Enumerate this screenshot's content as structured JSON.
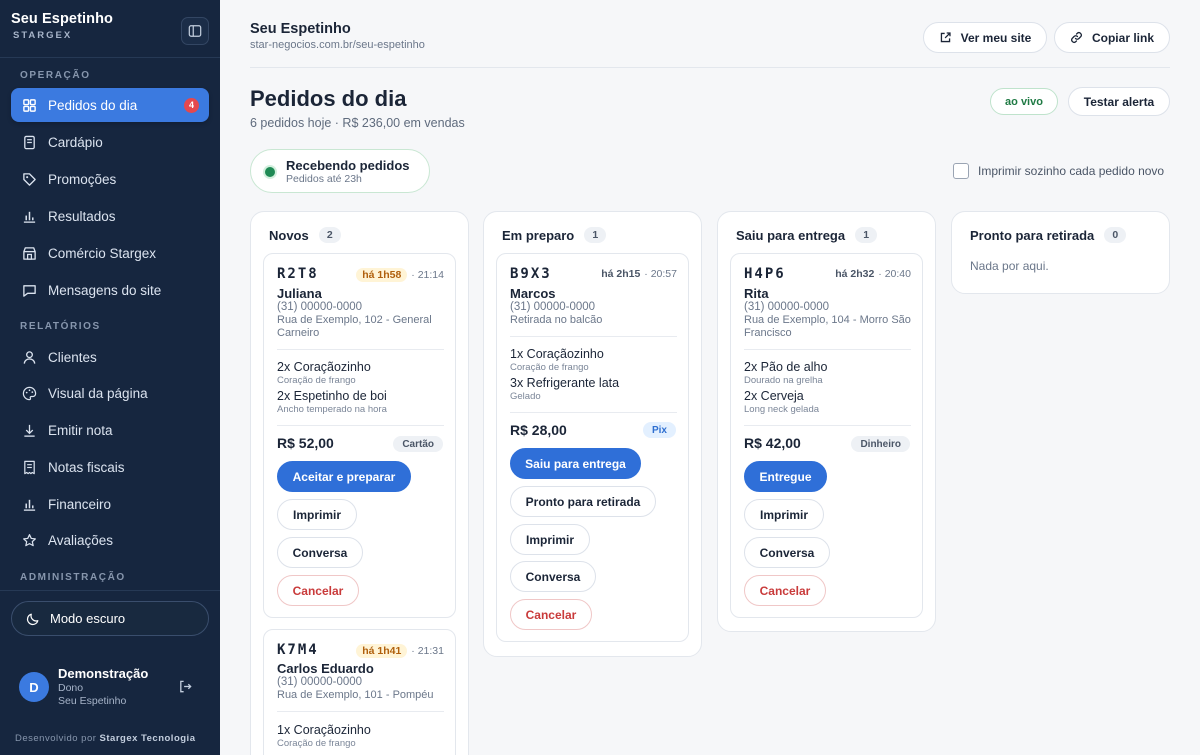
{
  "sidebar": {
    "brand_name": "Seu Espetinho",
    "brand_sub": "STARGEX",
    "sections": {
      "operacao": "OPERAÇÃO",
      "relatorios": "RELATÓRIOS",
      "administracao": "ADMINISTRAÇÃO"
    },
    "items": [
      {
        "label": "Pedidos do dia",
        "icon": "grid-icon",
        "badge": "4",
        "active": true
      },
      {
        "label": "Cardápio",
        "icon": "menu-book-icon"
      },
      {
        "label": "Promoções",
        "icon": "tag-icon"
      },
      {
        "label": "Resultados",
        "icon": "bar-chart-icon"
      },
      {
        "label": "Comércio Stargex",
        "icon": "store-icon"
      },
      {
        "label": "Mensagens do site",
        "icon": "message-icon"
      },
      {
        "label": "Clientes",
        "icon": "user-icon"
      },
      {
        "label": "Visual da página",
        "icon": "palette-icon"
      },
      {
        "label": "Emitir nota",
        "icon": "download-icon"
      },
      {
        "label": "Notas fiscais",
        "icon": "receipt-icon"
      },
      {
        "label": "Financeiro",
        "icon": "bar-chart-icon"
      },
      {
        "label": "Avaliações",
        "icon": "star-icon"
      }
    ],
    "dark_mode_label": "Modo escuro",
    "user": {
      "initial": "D",
      "name": "Demonstração",
      "role": "Dono",
      "store": "Seu Espetinho"
    },
    "credit_prefix": "Desenvolvido por",
    "credit_company": "Stargex Tecnologia"
  },
  "header": {
    "store_name": "Seu Espetinho",
    "store_url": "star-negocios.com.br/seu-espetinho",
    "view_site_label": "Ver meu site",
    "copy_link_label": "Copiar link"
  },
  "page": {
    "title": "Pedidos do dia",
    "subtitle": "6 pedidos hoje · R$ 236,00 em vendas",
    "live_label": "ao vivo",
    "test_alert_label": "Testar alerta",
    "status_title": "Recebendo pedidos",
    "status_sub": "Pedidos até 23h",
    "auto_print_label": "Imprimir sozinho cada pedido novo"
  },
  "columns": [
    {
      "title": "Novos",
      "count": "2"
    },
    {
      "title": "Em preparo",
      "count": "1"
    },
    {
      "title": "Saiu para entrega",
      "count": "1"
    },
    {
      "title": "Pronto para retirada",
      "count": "0",
      "empty": "Nada por aqui."
    }
  ],
  "orders": [
    {
      "code": "R2T8",
      "age": "há 1h58",
      "time": "· 21:14",
      "customer": "Juliana",
      "phone": "(31) 00000-0000",
      "address": "Rua de Exemplo, 102 - General Carneiro",
      "items": [
        {
          "name": "2x Coraçãozinho",
          "note": "Coração de frango"
        },
        {
          "name": "2x Espetinho de boi",
          "note": "Ancho temperado na hora"
        }
      ],
      "total": "R$ 52,00",
      "payment": "Cartão",
      "buttons": [
        "Aceitar e preparar",
        "Imprimir",
        "Conversa",
        "Cancelar"
      ]
    },
    {
      "code": "K7M4",
      "age": "há 1h41",
      "time": "· 21:31",
      "customer": "Carlos Eduardo",
      "phone": "(31) 00000-0000",
      "address": "Rua de Exemplo, 101 - Pompéu",
      "items": [
        {
          "name": "1x Coraçãozinho",
          "note": "Coração de frango"
        }
      ]
    },
    {
      "code": "B9X3",
      "age": "há 2h15",
      "time": "· 20:57",
      "customer": "Marcos",
      "phone": "(31) 00000-0000",
      "address": "Retirada no balcão",
      "items": [
        {
          "name": "1x Coraçãozinho",
          "note": "Coração de frango"
        },
        {
          "name": "3x Refrigerante lata",
          "note": "Gelado"
        }
      ],
      "total": "R$ 28,00",
      "payment": "Pix",
      "buttons": [
        "Saiu para entrega",
        "Pronto para retirada",
        "Imprimir",
        "Conversa",
        "Cancelar"
      ]
    },
    {
      "code": "H4P6",
      "age": "há 2h32",
      "time": "· 20:40",
      "customer": "Rita",
      "phone": "(31) 00000-0000",
      "address": "Rua de Exemplo, 104 - Morro São Francisco",
      "items": [
        {
          "name": "2x Pão de alho",
          "note": "Dourado na grelha"
        },
        {
          "name": "2x Cerveja",
          "note": "Long neck gelada"
        }
      ],
      "total": "R$ 42,00",
      "payment": "Dinheiro",
      "buttons": [
        "Entregue",
        "Imprimir",
        "Conversa",
        "Cancelar"
      ]
    }
  ],
  "colors": {
    "sidebar_bg": "#16263f",
    "accent": "#3b7ae0",
    "live_green": "#1f8a55",
    "danger": "#c93b3b",
    "warn_bg": "#fff4d6"
  }
}
